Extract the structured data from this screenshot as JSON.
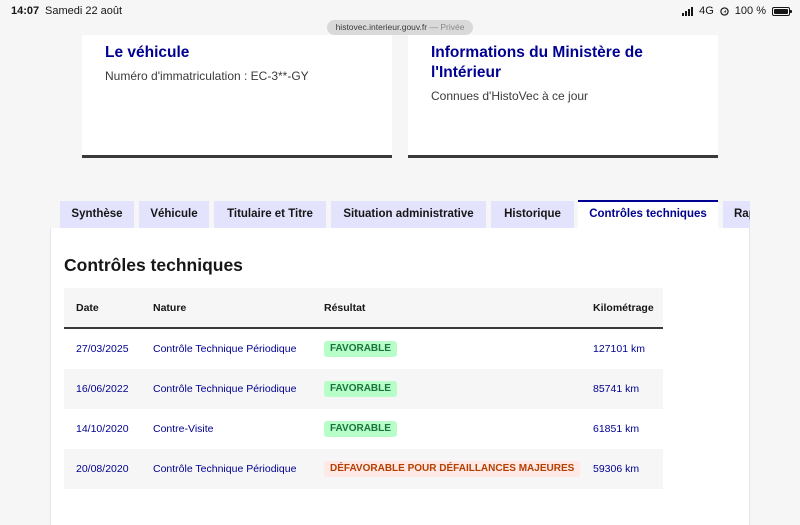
{
  "status_bar": {
    "time": "14:07",
    "date": "Samedi 22 août",
    "network": "4G",
    "battery": "100 %",
    "battery_level": 1.0
  },
  "url_bar": {
    "domain": "histovec.interieur.gouv.fr",
    "separator": "—",
    "mode": "Privée"
  },
  "cards": {
    "vehicle": {
      "title": "Le véhicule",
      "subtitle": "Numéro d'immatriculation : EC-3**-GY"
    },
    "ministry": {
      "title": "Informations du Ministère de l'Intérieur",
      "subtitle": "Connues d'HistoVec à ce jour"
    }
  },
  "tabs": [
    {
      "label": "Synthèse",
      "active": false
    },
    {
      "label": "Véhicule",
      "active": false
    },
    {
      "label": "Titulaire et Titre",
      "active": false
    },
    {
      "label": "Situation administrative",
      "active": false
    },
    {
      "label": "Historique",
      "active": false
    },
    {
      "label": "Contrôles techniques",
      "active": true
    },
    {
      "label": "Rapport",
      "active": false
    }
  ],
  "section": {
    "title": "Contrôles techniques"
  },
  "table": {
    "headers": {
      "date": "Date",
      "nature": "Nature",
      "result": "Résultat",
      "mileage": "Kilométrage"
    },
    "rows": [
      {
        "date": "27/03/2025",
        "nature": "Contrôle Technique Périodique",
        "result": "FAVORABLE",
        "result_status": "favorable",
        "mileage": "127101 km"
      },
      {
        "date": "16/06/2022",
        "nature": "Contrôle Technique Périodique",
        "result": "FAVORABLE",
        "result_status": "favorable",
        "mileage": "85741 km"
      },
      {
        "date": "14/10/2020",
        "nature": "Contre-Visite",
        "result": "FAVORABLE",
        "result_status": "favorable",
        "mileage": "61851 km"
      },
      {
        "date": "20/08/2020",
        "nature": "Contrôle Technique Périodique",
        "result": "DÉFAVORABLE POUR DÉFAILLANCES MAJEURES",
        "result_status": "defavorable",
        "mileage": "59306 km"
      }
    ]
  },
  "colors": {
    "brand_blue": "#000091",
    "tab_background": "#e3e3fd",
    "success_bg": "#b8fec9",
    "success_text": "#18753c",
    "error_bg": "#ffe9e6",
    "error_text": "#b34000"
  },
  "icons": {
    "signal": "signal-bars-icon",
    "location": "location-icon",
    "battery": "battery-icon"
  }
}
